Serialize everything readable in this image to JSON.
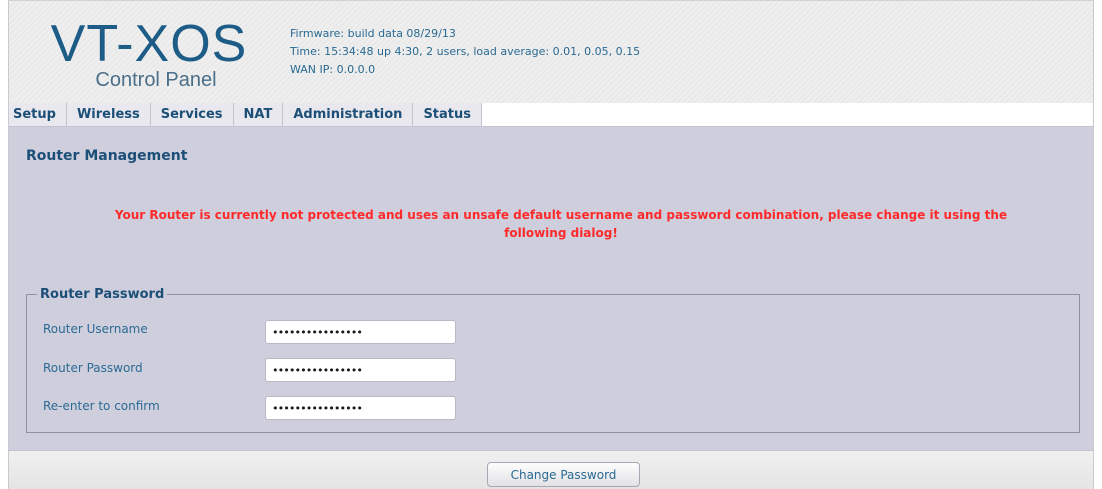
{
  "header": {
    "logo_title": "VT-XOS",
    "logo_subtitle": "Control Panel",
    "firmware": "Firmware: build data 08/29/13",
    "time": "Time: 15:34:48 up 4:30, 2 users, load average: 0.01, 0.05, 0.15",
    "wan_ip": "WAN IP: 0.0.0.0"
  },
  "tabs": [
    {
      "label": "Setup"
    },
    {
      "label": "Wireless"
    },
    {
      "label": "Services"
    },
    {
      "label": "NAT"
    },
    {
      "label": "Administration"
    },
    {
      "label": "Status"
    }
  ],
  "main": {
    "title": "Router Management",
    "warning_line1": "Your Router is currently not protected and uses an unsafe default username and password combination, please change it using the",
    "warning_line2": "following dialog!",
    "fieldset_legend": "Router Password",
    "fields": [
      {
        "label": "Router Username",
        "value": "••••••••••••••••"
      },
      {
        "label": "Router Password",
        "value": "••••••••••••••••"
      },
      {
        "label": "Re-enter to confirm",
        "value": "••••••••••••••••"
      }
    ]
  },
  "footer": {
    "button_label": "Change Password"
  },
  "colors": {
    "accent": "#1c4f77",
    "warning": "#ff2a2a",
    "background": "#cfcedd"
  }
}
